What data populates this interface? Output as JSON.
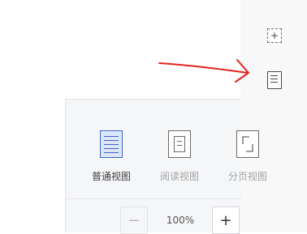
{
  "sidebar": {
    "add_icon_glyph": "+",
    "add_button_icon": "add-page-icon",
    "page_view_icon": "document-icon"
  },
  "annotation": {
    "arrow_color": "#e0241b"
  },
  "view_panel": {
    "options": [
      {
        "label": "普通视图",
        "icon": "normal-view-icon",
        "active": true
      },
      {
        "label": "阅读视图",
        "icon": "reading-view-icon",
        "active": false
      },
      {
        "label": "分页视图",
        "icon": "page-view-icon",
        "active": false
      }
    ],
    "zoom": {
      "minus": "−",
      "value": "100%",
      "plus": "+"
    }
  },
  "colors": {
    "accent": "#3a66c7",
    "accent_bg": "#dde7fb",
    "arrow": "#e0241b"
  }
}
